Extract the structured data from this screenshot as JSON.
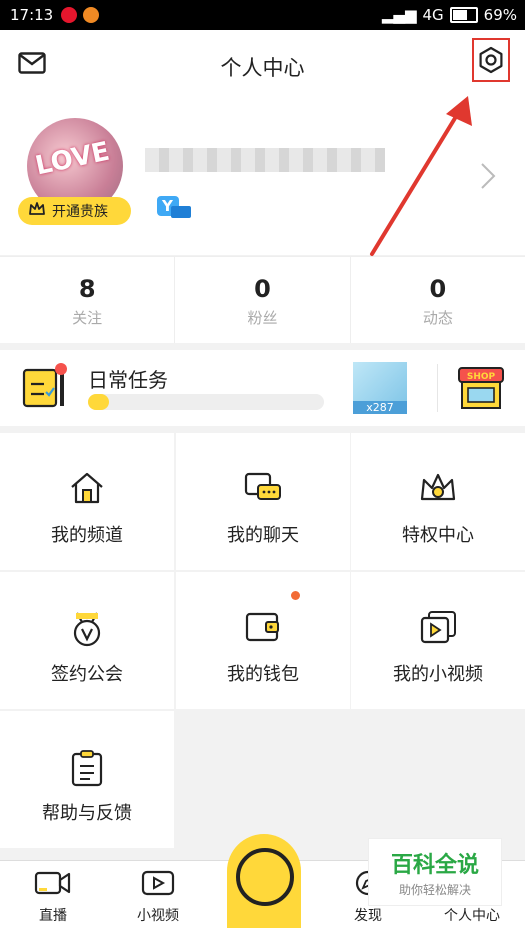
{
  "statusbar": {
    "time": "17:13",
    "network": "4G",
    "battery": "69%",
    "battery_level": 0.69
  },
  "header": {
    "title": "个人中心"
  },
  "profile": {
    "noble_label": "开通贵族",
    "level_badge": "Y"
  },
  "stats": [
    {
      "num": "8",
      "label": "关注"
    },
    {
      "num": "0",
      "label": "粉丝"
    },
    {
      "num": "0",
      "label": "动态"
    }
  ],
  "task": {
    "label": "日常任务",
    "progress": 0.09,
    "gift_count": "x287",
    "shop_text": "SHOP"
  },
  "grid": [
    {
      "label": "我的频道",
      "icon": "home-icon"
    },
    {
      "label": "我的聊天",
      "icon": "chat-icon"
    },
    {
      "label": "特权中心",
      "icon": "crown-icon"
    },
    {
      "label": "签约公会",
      "icon": "medal-icon"
    },
    {
      "label": "我的钱包",
      "icon": "wallet-icon"
    },
    {
      "label": "我的小视频",
      "icon": "video-stack-icon"
    },
    {
      "label": "帮助与反馈",
      "icon": "clipboard-icon"
    }
  ],
  "tabbar": [
    {
      "label": "直播",
      "icon": "camera-icon"
    },
    {
      "label": "小视频",
      "icon": "play-icon"
    },
    {
      "label": "发现",
      "icon": "discover-icon"
    },
    {
      "label": "个人中心",
      "icon": "person-icon"
    }
  ],
  "watermark": {
    "title": "百科全说",
    "subtitle": "助你轻松解决"
  },
  "colors": {
    "accent": "#ffd83a",
    "annotation": "#e0382f",
    "notify": "#f26b35"
  }
}
